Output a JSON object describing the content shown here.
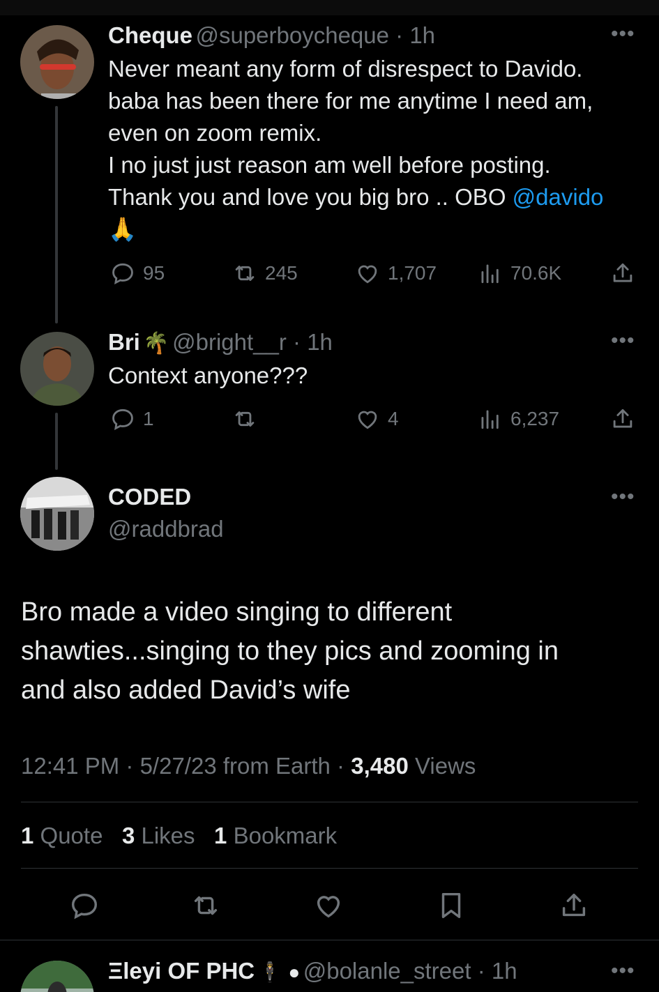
{
  "tweets": [
    {
      "name": "Cheque",
      "handle": "@superboycheque",
      "time": "1h",
      "lines": [
        "Never meant any form of disrespect to Davido.",
        "baba has been there for me anytime I need am,",
        "even on zoom remix.",
        "I no just just reason am well before posting."
      ],
      "last_line_text": "Thank you and love you big bro .. OBO ",
      "mention": "@davido",
      "emoji": "🙏",
      "replies": "95",
      "retweets": "245",
      "likes": "1,707",
      "views": "70.6K"
    },
    {
      "name": "Bri",
      "name_emoji": "🌴",
      "handle": "@bright__r",
      "time": "1h",
      "text": "Context anyone???",
      "replies": "1",
      "retweets": "",
      "likes": "4",
      "views": "6,237"
    }
  ],
  "main": {
    "name": "CODED",
    "handle": "@raddbrad",
    "lines": [
      "Bro made a video singing to different",
      "shawties...singing to they pics and zooming in",
      "and also added David’s wife"
    ],
    "timestamp": "12:41 PM · 5/27/23 from Earth · ",
    "views_count": "3,480",
    "views_label": " Views",
    "quotes_count": "1",
    "quotes_label": " Quote",
    "likes_count": "3",
    "likes_label": " Likes",
    "bookmarks_count": "1",
    "bookmarks_label": " Bookmark"
  },
  "next_reply": {
    "name": "Ξleyi OF PHC",
    "name_emojis": "🕴 ",
    "handle": "@bolanle_street",
    "time": "1h"
  },
  "colors": {
    "background": "#000000",
    "text": "#e7e9ea",
    "muted": "#71767b",
    "accent": "#1d9bf0",
    "divider": "#2f3336"
  },
  "icons": {
    "reply": "reply-icon",
    "retweet": "retweet-icon",
    "like": "heart-icon",
    "views": "views-icon",
    "share": "share-icon",
    "bookmark": "bookmark-icon",
    "more": "more-icon"
  }
}
